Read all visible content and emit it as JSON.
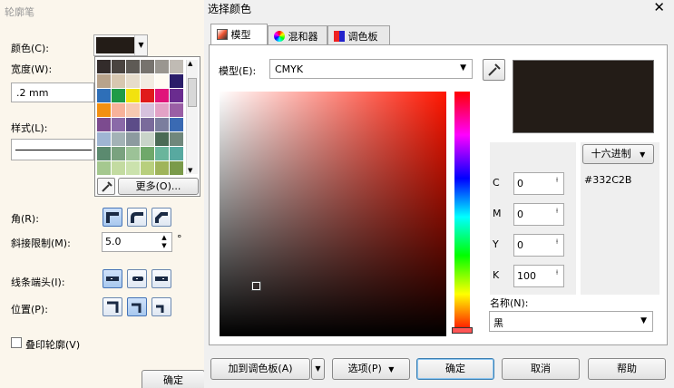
{
  "outline_dialog": {
    "title": "轮廓笔",
    "color_label": "颜色(C):",
    "width_label": "宽度(W):",
    "width_value": ".2 mm",
    "style_label": "样式(L):",
    "corner_label": "角(R):",
    "miter_label": "斜接限制(M):",
    "miter_value": "5.0",
    "degree_symbol": "°",
    "line_caps_label": "线条端头(I):",
    "position_label": "位置(P):",
    "overprint_label": "叠印轮廓(V)",
    "ok_label": "确定",
    "current_color": "#231c17",
    "palette": {
      "more_label": "更多(O)...",
      "swatches": [
        "#332c2b",
        "#4a4440",
        "#5e5a55",
        "#77736e",
        "#9a9690",
        "#c0bbb4",
        "#b8a38b",
        "#d7c7b0",
        "#e6dccb",
        "#f2ece1",
        "#fffbf2",
        "#2a1d6a",
        "#2e6fb8",
        "#1f9b47",
        "#f2e20f",
        "#e01b1b",
        "#e0157a",
        "#6a2c8f",
        "#f29012",
        "#f7b29a",
        "#f7c9b1",
        "#d6c2dd",
        "#e3a2c6",
        "#9a5fa5",
        "#7c4b8f",
        "#8a6aa8",
        "#5c4c88",
        "#7a6b9b",
        "#7b7e9e",
        "#3a6ab3",
        "#9fb5d3",
        "#a3b2b6",
        "#8c9a9f",
        "#c9d4c9",
        "#4a6a55",
        "#70877c",
        "#5b8a6f",
        "#7aa27f",
        "#9cc297",
        "#6fa86a",
        "#6ab59c",
        "#58a9a0",
        "#a5c88f",
        "#c3dba1",
        "#cbe2ad",
        "#b8cf7d",
        "#9fb45a",
        "#7a9a4a"
      ]
    }
  },
  "color_dialog": {
    "title": "选择颜色",
    "tabs": [
      {
        "label": "模型",
        "icon": "model-icon"
      },
      {
        "label": "混和器",
        "icon": "mixer-icon"
      },
      {
        "label": "调色板",
        "icon": "palette-icon"
      }
    ],
    "model_label": "模型(E):",
    "model_value": "CMYK",
    "hex_mode": "十六进制",
    "hex_value": "#332C2B",
    "preview_color": "#231c17",
    "cmyk": [
      {
        "label": "C",
        "value": "0"
      },
      {
        "label": "M",
        "value": "0"
      },
      {
        "label": "Y",
        "value": "0"
      },
      {
        "label": "K",
        "value": "100"
      }
    ],
    "name_label": "名称(N):",
    "name_value": "黑",
    "buttons": {
      "add_palette": "加到调色板(A)",
      "options": "选项(P)",
      "ok": "确定",
      "cancel": "取消",
      "help": "帮助"
    },
    "close_glyph": "✕"
  }
}
